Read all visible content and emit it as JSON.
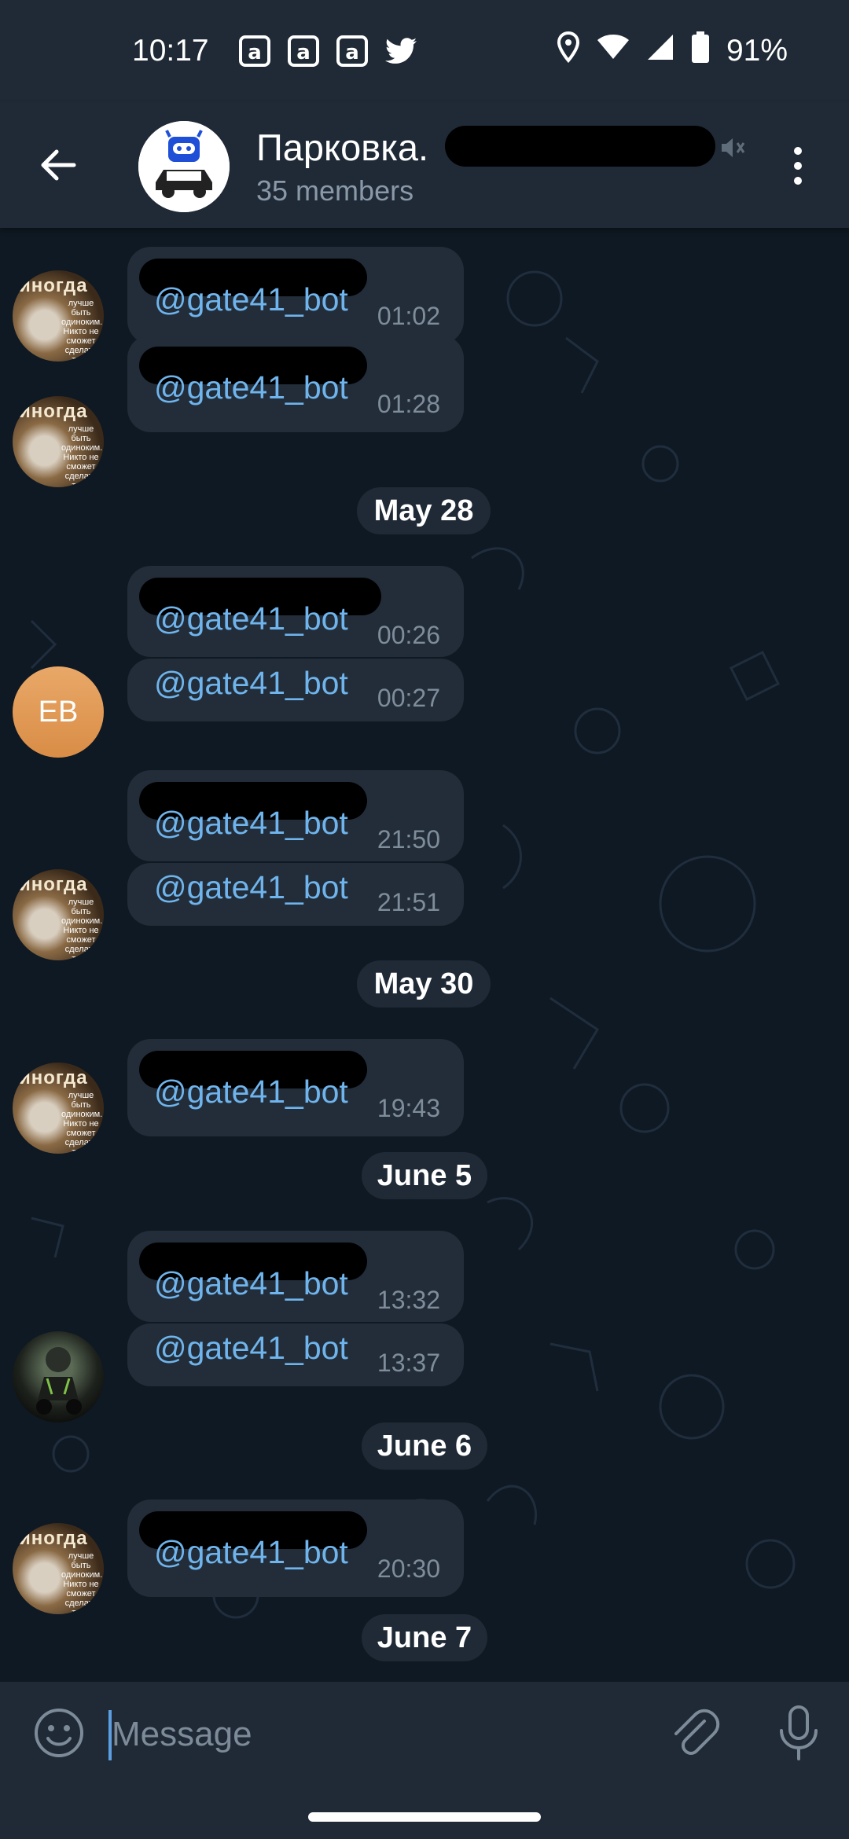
{
  "status_bar": {
    "time": "10:17",
    "battery": "91%",
    "notification_icons": [
      "a-icon",
      "a-icon",
      "a-icon",
      "twitter-icon"
    ]
  },
  "header": {
    "title": "Парковка.",
    "subtitle": "35 members"
  },
  "messages": [
    {
      "mention": "@gate41_bot",
      "time": "01:02"
    },
    {
      "mention": "@gate41_bot",
      "time": "01:28"
    },
    {
      "mention": "@gate41_bot",
      "time": "00:26"
    },
    {
      "mention": "@gate41_bot",
      "time": "00:27"
    },
    {
      "mention": "@gate41_bot",
      "time": "21:50"
    },
    {
      "mention": "@gate41_bot",
      "time": "21:51"
    },
    {
      "mention": "@gate41_bot",
      "time": "19:43"
    },
    {
      "mention": "@gate41_bot",
      "time": "13:32"
    },
    {
      "mention": "@gate41_bot",
      "time": "13:37"
    },
    {
      "mention": "@gate41_bot",
      "time": "20:30"
    }
  ],
  "dates": [
    "May 28",
    "May 30",
    "June 5",
    "June 6",
    "June 7"
  ],
  "avatars": {
    "eb_initials": "EB",
    "wolf_caption": "иногда",
    "wolf_text": "лучше быть одиноким. Никто не сможет сделать тебе больно"
  },
  "composer": {
    "placeholder": "Message"
  },
  "colors": {
    "header_bg": "#1f2a36",
    "chat_bg": "#0f1923",
    "bubble_bg": "#222d39",
    "mention": "#6fb4ec",
    "eb_avatar": "#e09a55"
  }
}
